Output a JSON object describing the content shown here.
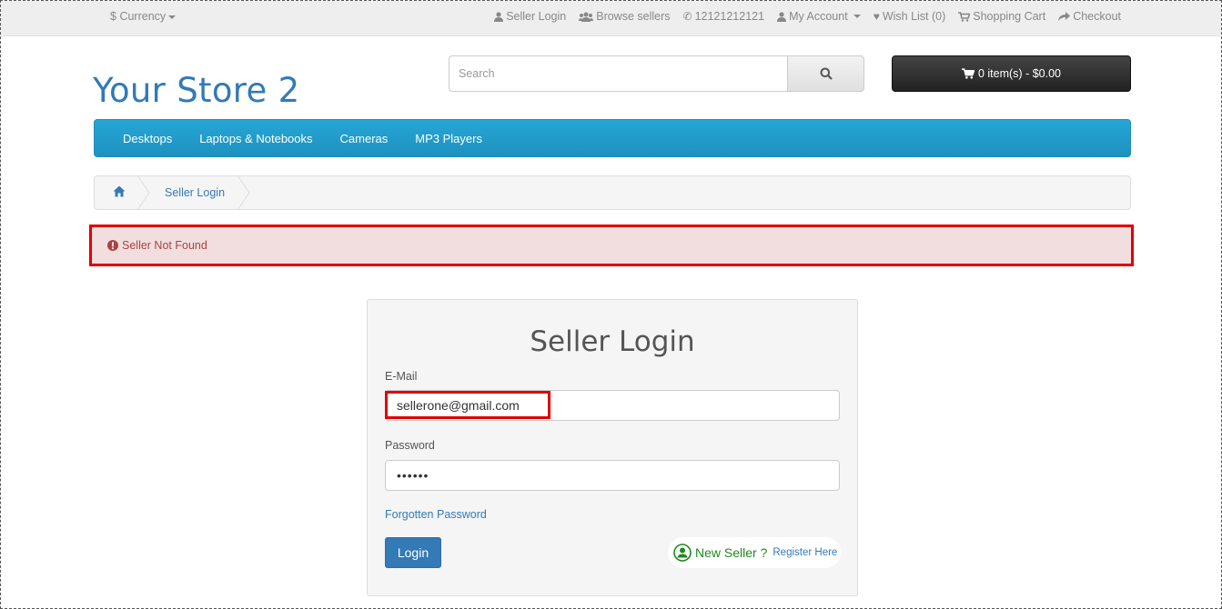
{
  "topbar": {
    "currency_label": "Currency",
    "currency_symbol": "$",
    "links": {
      "seller_login": "Seller Login",
      "browse_sellers": "Browse sellers",
      "phone": "12121212121",
      "my_account": "My Account",
      "wish_list": "Wish List (0)",
      "shopping_cart": "Shopping Cart",
      "checkout": "Checkout"
    }
  },
  "header": {
    "logo": "Your Store 2",
    "search_placeholder": "Search",
    "cart_label": "0 item(s) - $0.00"
  },
  "menu": {
    "items": [
      "Desktops",
      "Laptops & Notebooks",
      "Cameras",
      "MP3 Players"
    ]
  },
  "breadcrumb": {
    "current": "Seller Login"
  },
  "alert": {
    "message": "Seller Not Found"
  },
  "login": {
    "title": "Seller Login",
    "email_label": "E-Mail",
    "email_value": "sellerone@gmail.com",
    "password_label": "Password",
    "password_value": "••••••",
    "forgot_link": "Forgotten Password",
    "login_button": "Login",
    "new_seller": "New Seller ?",
    "register_link": "Register Here"
  },
  "colors": {
    "link_blue": "#337ab7",
    "menu_blue": "#229ac8",
    "alert_bg": "#f2dede",
    "highlight_red": "#e00000",
    "new_seller_green": "#1e8a1e"
  }
}
